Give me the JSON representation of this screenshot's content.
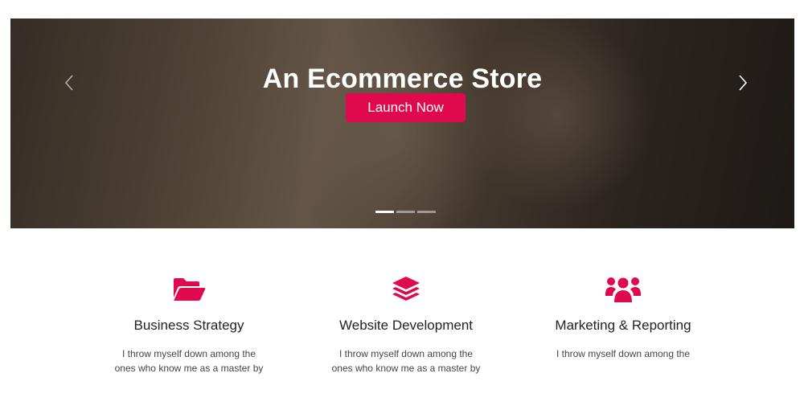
{
  "hero": {
    "title": "An Ecommerce Store",
    "button_label": "Launch Now",
    "slides_count": 3,
    "active_slide": 1
  },
  "features": [
    {
      "icon": "folder-open-icon",
      "title": "Business Strategy",
      "text": "I throw myself down among the ones who know me as a master by"
    },
    {
      "icon": "layers-icon",
      "title": "Website Development",
      "text": "I throw myself down among the ones who know me as a master by"
    },
    {
      "icon": "users-icon",
      "title": "Marketing & Reporting",
      "text": "I throw myself down among the"
    }
  ],
  "colors": {
    "accent": "#e0094d",
    "heading": "#222222",
    "body_text": "#444444"
  }
}
